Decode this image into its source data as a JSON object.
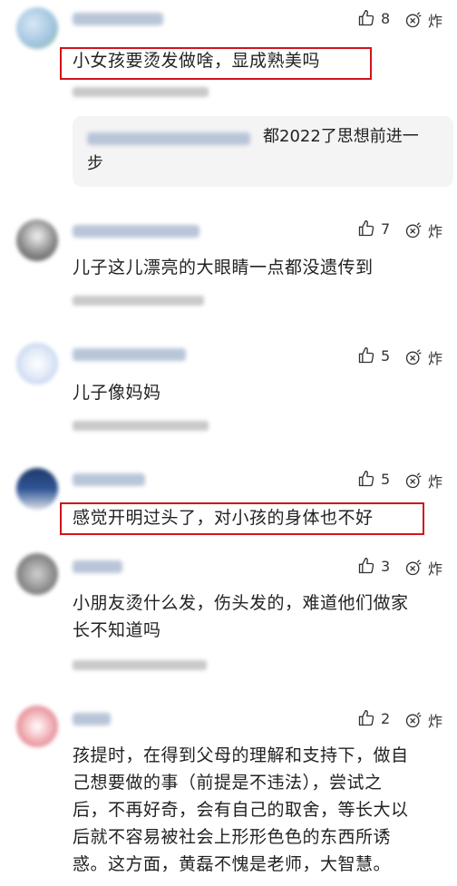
{
  "comments": [
    {
      "likes": "8",
      "react": "炸",
      "text": "小女孩要烫发做啥，显成熟美吗"
    },
    {
      "likes": "7",
      "react": "炸",
      "text": "儿子这儿漂亮的大眼睛一点都没遗传到"
    },
    {
      "likes": "5",
      "react": "炸",
      "text": "儿子像妈妈"
    },
    {
      "likes": "5",
      "react": "炸",
      "text": "感觉开明过头了，对小孩的身体也不好"
    },
    {
      "likes": "3",
      "react": "炸",
      "text_l1": "小朋友烫什么发，伤头发的，难道他们做家",
      "text_l2": "长不知道吗"
    },
    {
      "likes": "2",
      "react": "炸",
      "text_l1": "孩提时，在得到父母的理解和支持下，做自",
      "text_l2": "己想要做的事（前提是不违法），尝试之",
      "text_l3": "后，不再好奇，会有自己的取舍，等长大以",
      "text_l4": "后就不容易被社会上形形色色的东西所诱",
      "text_l5": "惑。这方面，黄磊不愧是老师，大智慧。"
    }
  ],
  "reply": {
    "text_l1": "都2022了思想前进一",
    "text_l2": "步"
  },
  "colors": {
    "highlight": "#d0141a",
    "reply_bg": "#f4f4f5"
  },
  "icons": {
    "like": "thumbs-up-icon",
    "react": "explosion-react-icon"
  }
}
